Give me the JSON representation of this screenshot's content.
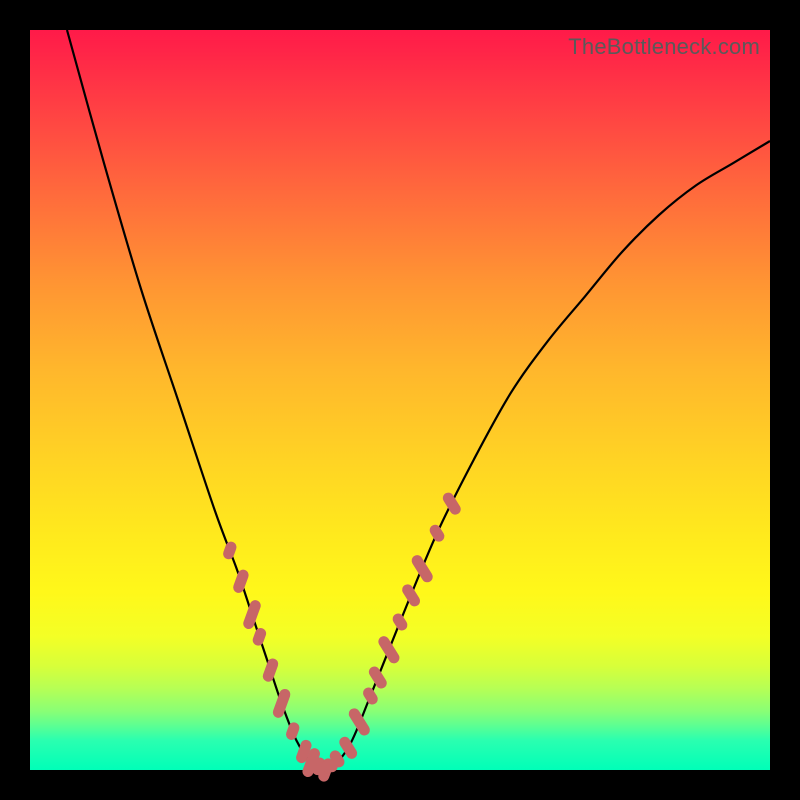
{
  "watermark": "TheBottleneck.com",
  "colors": {
    "background": "#000000",
    "gradient_top": "#ff1a49",
    "gradient_bottom": "#00ffb8",
    "curve": "#000000",
    "marker": "#c76667"
  },
  "chart_data": {
    "type": "line",
    "title": "",
    "xlabel": "",
    "ylabel": "",
    "xlim": [
      0,
      100
    ],
    "ylim": [
      0,
      100
    ],
    "x": [
      5,
      10,
      15,
      20,
      25,
      28,
      30,
      32,
      34,
      36,
      38,
      40,
      43,
      46,
      50,
      55,
      60,
      65,
      70,
      75,
      80,
      85,
      90,
      95,
      100
    ],
    "values": [
      100,
      82,
      65,
      50,
      35,
      27,
      21,
      15,
      9,
      4,
      1,
      0,
      3,
      10,
      20,
      32,
      42,
      51,
      58,
      64,
      70,
      75,
      79,
      82,
      85
    ],
    "series": [
      {
        "name": "bottleneck-curve",
        "x": [
          5,
          10,
          15,
          20,
          25,
          28,
          30,
          32,
          34,
          36,
          38,
          40,
          43,
          46,
          50,
          55,
          60,
          65,
          70,
          75,
          80,
          85,
          90,
          95,
          100
        ],
        "values": [
          100,
          82,
          65,
          50,
          35,
          27,
          21,
          15,
          9,
          4,
          1,
          0,
          3,
          10,
          20,
          32,
          42,
          51,
          58,
          64,
          70,
          75,
          79,
          82,
          85
        ]
      }
    ],
    "markers": {
      "left_cluster_x": [
        27,
        28.5,
        30,
        31,
        32.5,
        34,
        35.5,
        37,
        38,
        39,
        40
      ],
      "right_cluster_x": [
        41.5,
        43,
        44.5,
        46,
        47,
        48.5,
        50,
        51.5,
        53,
        55,
        57
      ]
    },
    "floor_band_start_y": 11
  }
}
